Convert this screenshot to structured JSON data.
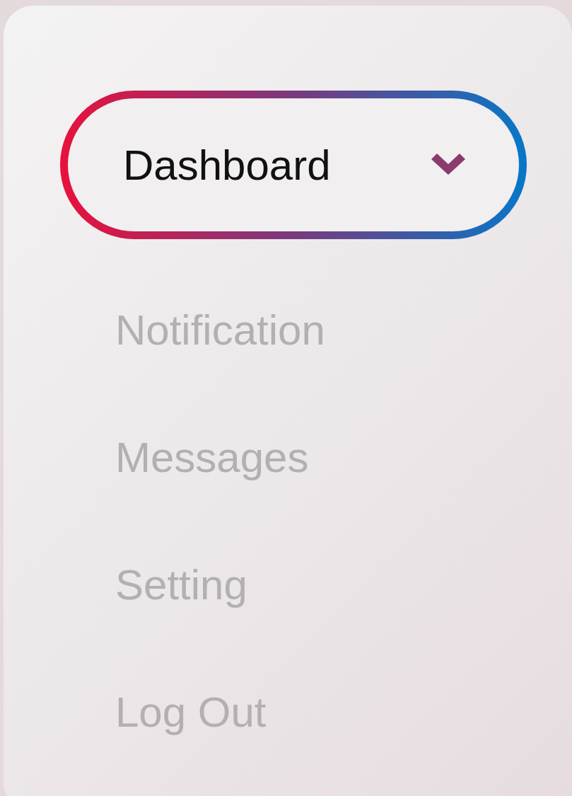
{
  "menu": {
    "items": [
      {
        "label": "Dashboard",
        "selected": true
      },
      {
        "label": "Notification",
        "selected": false
      },
      {
        "label": "Messages",
        "selected": false
      },
      {
        "label": "Setting",
        "selected": false
      },
      {
        "label": "Log Out",
        "selected": false
      }
    ]
  }
}
